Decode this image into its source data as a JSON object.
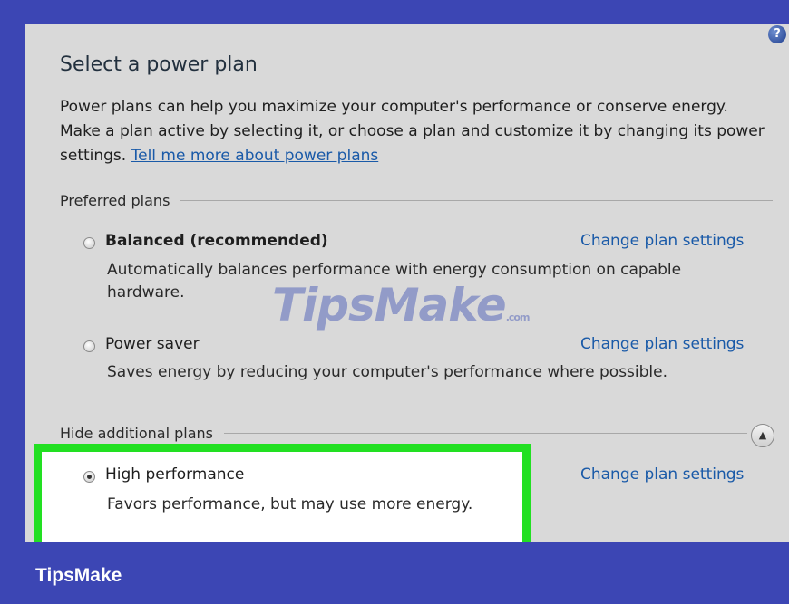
{
  "help_icon": {
    "name": "help-icon",
    "glyph": "?"
  },
  "title": "Select a power plan",
  "intro": {
    "line1": "Power plans can help you maximize your computer's performance or conserve energy.",
    "line2": "Make a plan active by selecting it, or choose a plan and customize it by changing its power",
    "line3_prefix": "settings. ",
    "link": "Tell me more about power plans"
  },
  "groups": {
    "preferred": "Preferred plans",
    "additional": "Hide additional plans"
  },
  "plans": [
    {
      "name": "Balanced (recommended)",
      "desc_line1": "Automatically balances performance with energy consumption on capable",
      "desc_line2": "hardware.",
      "link": "Change plan settings",
      "selected": false
    },
    {
      "name": "Power saver",
      "desc_line1": "Saves energy by reducing your computer's performance where possible.",
      "link": "Change plan settings",
      "selected": false
    },
    {
      "name": "High performance",
      "desc_line1": "Favors performance, but may use more energy.",
      "link": "Change plan settings",
      "selected": true
    }
  ],
  "collapse_icon": "chevron-up-icon",
  "watermark": {
    "main": "TipsMake",
    "suffix": ".com"
  },
  "brand": "TipsMake",
  "colors": {
    "background": "#3c46b4",
    "panel": "#d9d9d9",
    "highlight": "#22e022",
    "link": "#1a5aa8"
  }
}
